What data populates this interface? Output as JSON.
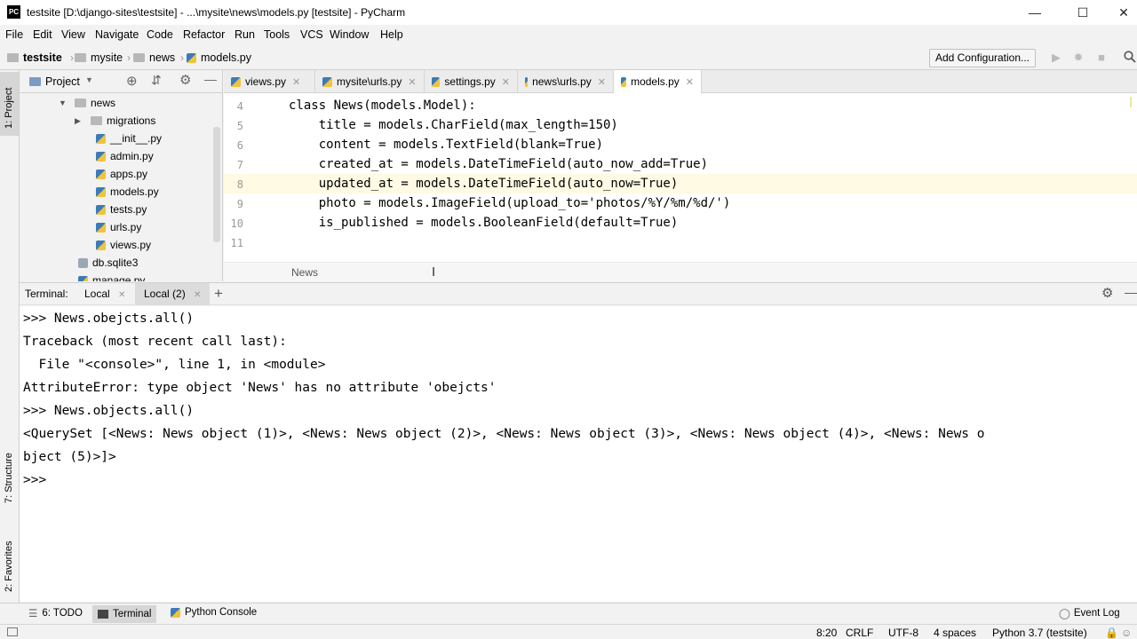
{
  "window": {
    "title": "testsite [D:\\django-sites\\testsite] - ...\\mysite\\news\\models.py [testsite] - PyCharm",
    "logo": "PC",
    "minimize": "—",
    "maximize": "☐",
    "close": "✕"
  },
  "menu": [
    "File",
    "Edit",
    "View",
    "Navigate",
    "Code",
    "Refactor",
    "Run",
    "Tools",
    "VCS",
    "Window",
    "Help"
  ],
  "breadcrumb": [
    "testsite",
    "mysite",
    "news",
    "models.py"
  ],
  "toolbar": {
    "add_configuration": "Add Configuration..."
  },
  "left_strip": {
    "project_tab": "1: Project",
    "structure_tab": "7: Structure",
    "favorites_tab": "2: Favorites"
  },
  "project_panel": {
    "header": "Project",
    "tree": [
      {
        "label": "news",
        "type": "folder",
        "expanded": true
      },
      {
        "label": "migrations",
        "type": "folder",
        "expanded": false
      },
      {
        "label": "__init__.py",
        "type": "file"
      },
      {
        "label": "admin.py",
        "type": "file"
      },
      {
        "label": "apps.py",
        "type": "file"
      },
      {
        "label": "models.py",
        "type": "file"
      },
      {
        "label": "tests.py",
        "type": "file"
      },
      {
        "label": "urls.py",
        "type": "file"
      },
      {
        "label": "views.py",
        "type": "file"
      },
      {
        "label": "db.sqlite3",
        "type": "file"
      },
      {
        "label": "manage.py",
        "type": "file"
      }
    ]
  },
  "editor_tabs": [
    {
      "label": "views.py",
      "active": false
    },
    {
      "label": "mysite\\urls.py",
      "active": false
    },
    {
      "label": "settings.py",
      "active": false
    },
    {
      "label": "news\\urls.py",
      "active": false
    },
    {
      "label": "models.py",
      "active": true
    }
  ],
  "editor": {
    "line_numbers": [
      "4",
      "5",
      "6",
      "7",
      "8",
      "9",
      "10",
      "11"
    ],
    "lines": [
      "class News(models.Model):",
      "    title = models.CharField(max_length=150)",
      "    content = models.TextField(blank=True)",
      "    created_at = models.DateTimeField(auto_now_add=True)",
      "    updated_at = models.DateTimeField(auto_now=True)",
      "    photo = models.ImageField(upload_to='photos/%Y/%m/%d/')",
      "    is_published = models.BooleanField(default=True)",
      ""
    ],
    "current_line": "8",
    "breadcrumb": "News"
  },
  "terminal": {
    "label": "Terminal:",
    "tabs": [
      "Local",
      "Local (2)"
    ],
    "lines": [
      ">>> News.obejcts.all()",
      "Traceback (most recent call last):",
      "  File \"<console>\", line 1, in <module>",
      "AttributeError: type object 'News' has no attribute 'obejcts'",
      ">>> News.objects.all()",
      "<QuerySet [<News: News object (1)>, <News: News object (2)>, <News: News object (3)>, <News: News object (4)>, <News: News o",
      "bject (5)>]>",
      ">>>"
    ]
  },
  "bottom_tabs": [
    {
      "label": "6: TODO",
      "active": false
    },
    {
      "label": "Terminal",
      "active": true
    },
    {
      "label": "Python Console",
      "active": false
    }
  ],
  "event_log": "Event Log",
  "status": {
    "position": "8:20",
    "line_sep": "CRLF",
    "encoding": "UTF-8",
    "indent": "4 spaces",
    "interpreter": "Python 3.7 (testsite)"
  }
}
